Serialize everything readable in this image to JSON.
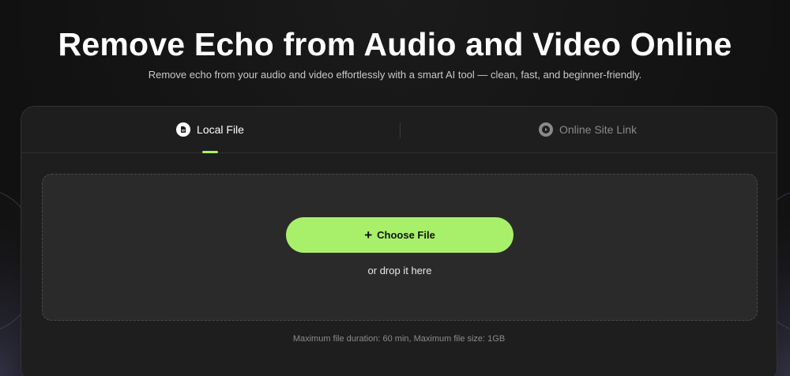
{
  "header": {
    "title": "Remove Echo from Audio and Video Online",
    "subtitle": "Remove echo from your audio and video effortlessly with a smart AI tool — clean, fast, and beginner-friendly."
  },
  "tabs": [
    {
      "label": "Local File",
      "icon": "file-icon",
      "active": true
    },
    {
      "label": "Online Site Link",
      "icon": "play-circle-icon",
      "active": false
    }
  ],
  "upload": {
    "button_label": "Choose File",
    "button_icon": "plus-icon",
    "drop_text": "or drop it here",
    "limits_text": "Maximum file duration: 60 min, Maximum file size: 1GB"
  },
  "colors": {
    "accent": "#a8f06a",
    "background": "#111111",
    "panel": "#1e1e1e",
    "dropzone": "#2a2a2a"
  }
}
